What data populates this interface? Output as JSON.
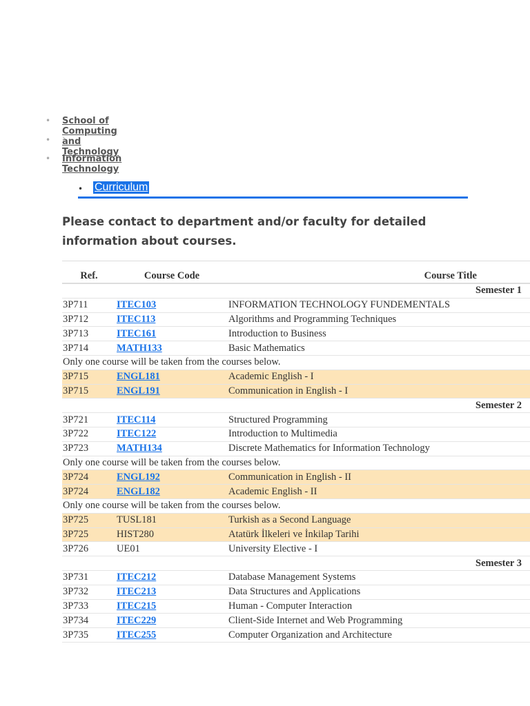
{
  "breadcrumb": {
    "items": [
      "School of Computing and Technology",
      "›",
      "Information Technology"
    ]
  },
  "tabs": {
    "active": "Curriculum"
  },
  "notice": "Please contact to department and/or faculty for detailed information about courses.",
  "table": {
    "headers": [
      "Ref.",
      "Course Code",
      "Course Title"
    ],
    "rows": [
      {
        "type": "semester",
        "label": "Semester 1"
      },
      {
        "ref": "3P711",
        "code": "ITEC103",
        "link": true,
        "title": "INFORMATION TECHNOLOGY FUNDEMENTALS"
      },
      {
        "ref": "3P712",
        "code": "ITEC113",
        "link": true,
        "title": "Algorithms and Programming Techniques"
      },
      {
        "ref": "3P713",
        "code": "ITEC161",
        "link": true,
        "title": "Introduction to Business"
      },
      {
        "ref": "3P714",
        "code": "MATH133",
        "link": true,
        "title": "Basic Mathematics"
      },
      {
        "type": "note",
        "label": "Only one course will be taken from the courses below."
      },
      {
        "ref": "3P715",
        "code": "ENGL181",
        "link": true,
        "alt": true,
        "title": "Academic English - I"
      },
      {
        "ref": "3P715",
        "code": "ENGL191",
        "link": true,
        "alt": true,
        "title": "Communication in English - I"
      },
      {
        "type": "semester",
        "label": "Semester 2"
      },
      {
        "ref": "3P721",
        "code": "ITEC114",
        "link": true,
        "title": "Structured Programming"
      },
      {
        "ref": "3P722",
        "code": "ITEC122",
        "link": true,
        "title": "Introduction to Multimedia"
      },
      {
        "ref": "3P723",
        "code": "MATH134",
        "link": true,
        "title": "Discrete Mathematics for Information Technology"
      },
      {
        "type": "note",
        "label": "Only one course will be taken from the courses below."
      },
      {
        "ref": "3P724",
        "code": "ENGL192",
        "link": true,
        "alt": true,
        "title": "Communication in English - II"
      },
      {
        "ref": "3P724",
        "code": "ENGL182",
        "link": true,
        "alt": true,
        "title": "Academic English - II"
      },
      {
        "type": "note",
        "label": "Only one course will be taken from the courses below."
      },
      {
        "ref": "3P725",
        "code": "TUSL181",
        "link": false,
        "alt": true,
        "title": "Turkish as a Second Language"
      },
      {
        "ref": "3P725",
        "code": "HIST280",
        "link": false,
        "alt": true,
        "title": "Atatürk İlkeleri ve İnkilap Tarihi"
      },
      {
        "ref": "3P726",
        "code": "UE01",
        "link": false,
        "title": "University Elective - I"
      },
      {
        "type": "semester",
        "label": "Semester 3"
      },
      {
        "ref": "3P731",
        "code": "ITEC212",
        "link": true,
        "title": "Database Management Systems"
      },
      {
        "ref": "3P732",
        "code": "ITEC213",
        "link": true,
        "title": "Data Structures and Applications"
      },
      {
        "ref": "3P733",
        "code": "ITEC215",
        "link": true,
        "title": "Human - Computer Interaction"
      },
      {
        "ref": "3P734",
        "code": "ITEC229",
        "link": true,
        "title": "Client-Side Internet and Web Programming"
      },
      {
        "ref": "3P735",
        "code": "ITEC255",
        "link": true,
        "title": "Computer Organization and Architecture"
      }
    ]
  },
  "colors": {
    "accent": "#1a73e8",
    "highlight": "#fde4b8"
  }
}
